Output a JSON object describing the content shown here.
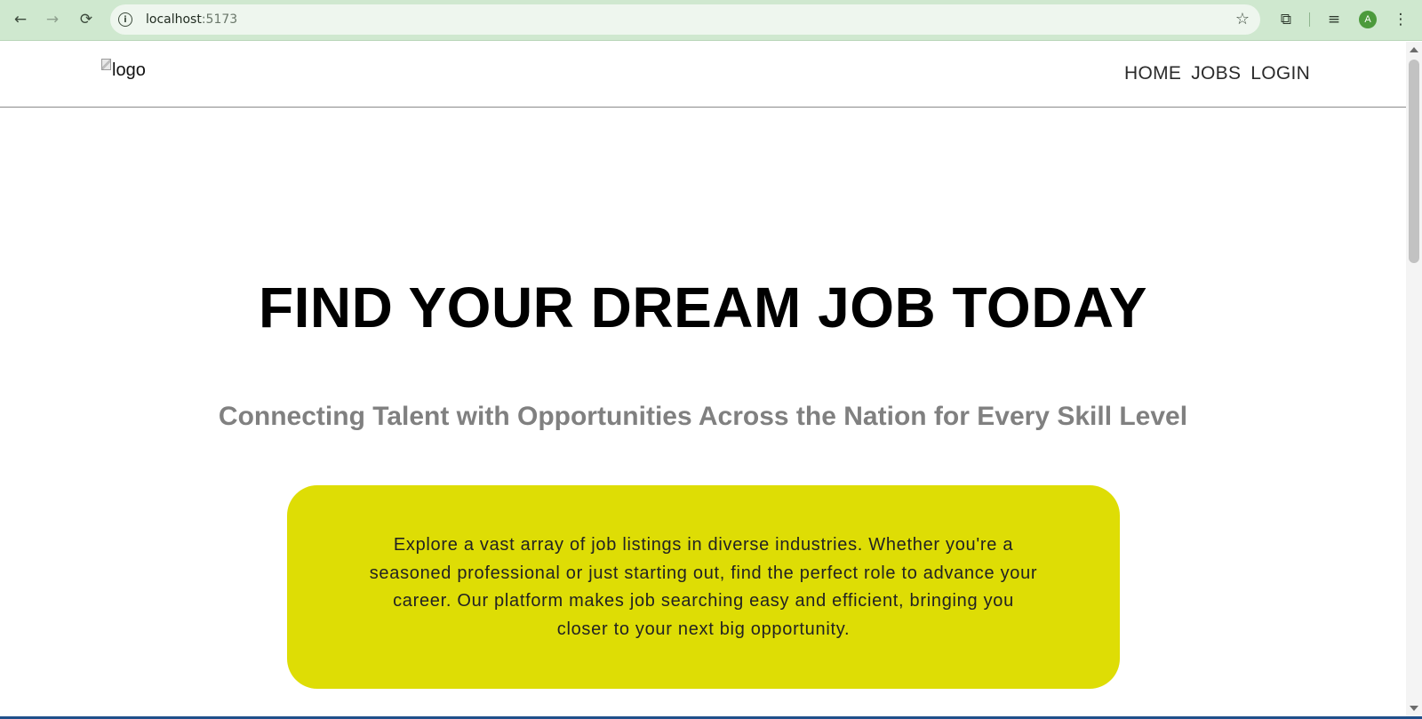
{
  "browser": {
    "url_host": "localhost",
    "url_port": ":5173",
    "back_icon": "←",
    "forward_icon": "→",
    "reload_icon": "⟳",
    "info_icon": "i",
    "star_icon": "☆",
    "extensions_icon": "⧉",
    "media_icon": "≡",
    "avatar_letter": "A",
    "menu_icon": "⋮"
  },
  "navbar": {
    "logo_alt": "logo",
    "links": [
      "HOME",
      "JOBS",
      "LOGIN"
    ]
  },
  "hero": {
    "title": "FIND YOUR DREAM JOB TODAY",
    "subtitle": "Connecting Talent with Opportunities Across the Nation for Every Skill Level",
    "description": "Explore a vast array of job listings in diverse industries. Whether you're a seasoned professional or just starting out, find the perfect role to advance your career. Our platform makes job searching easy and efficient, bringing you closer to your next big opportunity."
  },
  "colors": {
    "chrome_bg": "#cfe8cf",
    "card_bg": "#dedd05",
    "subtitle": "#808080"
  }
}
